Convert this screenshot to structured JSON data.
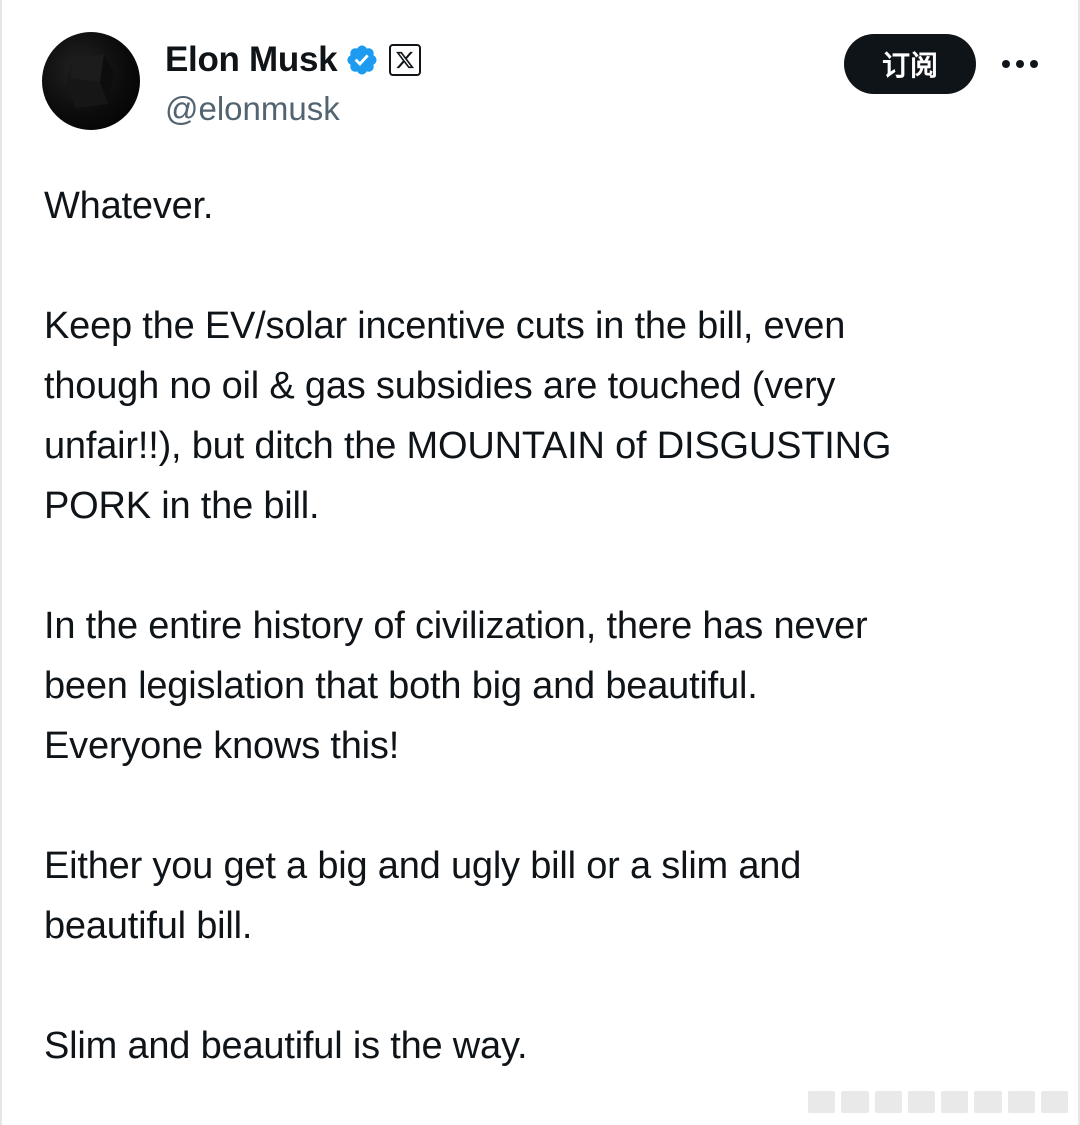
{
  "author": {
    "display_name": "Elon Musk",
    "handle": "@elonmusk",
    "verified_icon": "verified-badge-icon",
    "affiliation_icon": "x-logo-icon"
  },
  "actions": {
    "subscribe_label": "订阅",
    "more_icon": "more-horizontal-icon"
  },
  "tweet": {
    "paragraphs": [
      "Whatever.",
      "Keep the EV/solar incentive cuts in the bill, even\nthough no oil & gas subsidies are touched (very\nunfair!!), but ditch the MOUNTAIN of DISGUSTING\nPORK in the bill.",
      "In the entire history of civilization, there has never\nbeen legislation that both big and beautiful.\nEveryone knows this!",
      "Either you get a big and ugly bill or a slim and\nbeautiful bill.",
      "Slim and beautiful is the way."
    ]
  },
  "colors": {
    "text_primary": "#0f1419",
    "text_secondary": "#536471",
    "verified_blue": "#1d9bf0",
    "button_bg": "#0f1419"
  }
}
